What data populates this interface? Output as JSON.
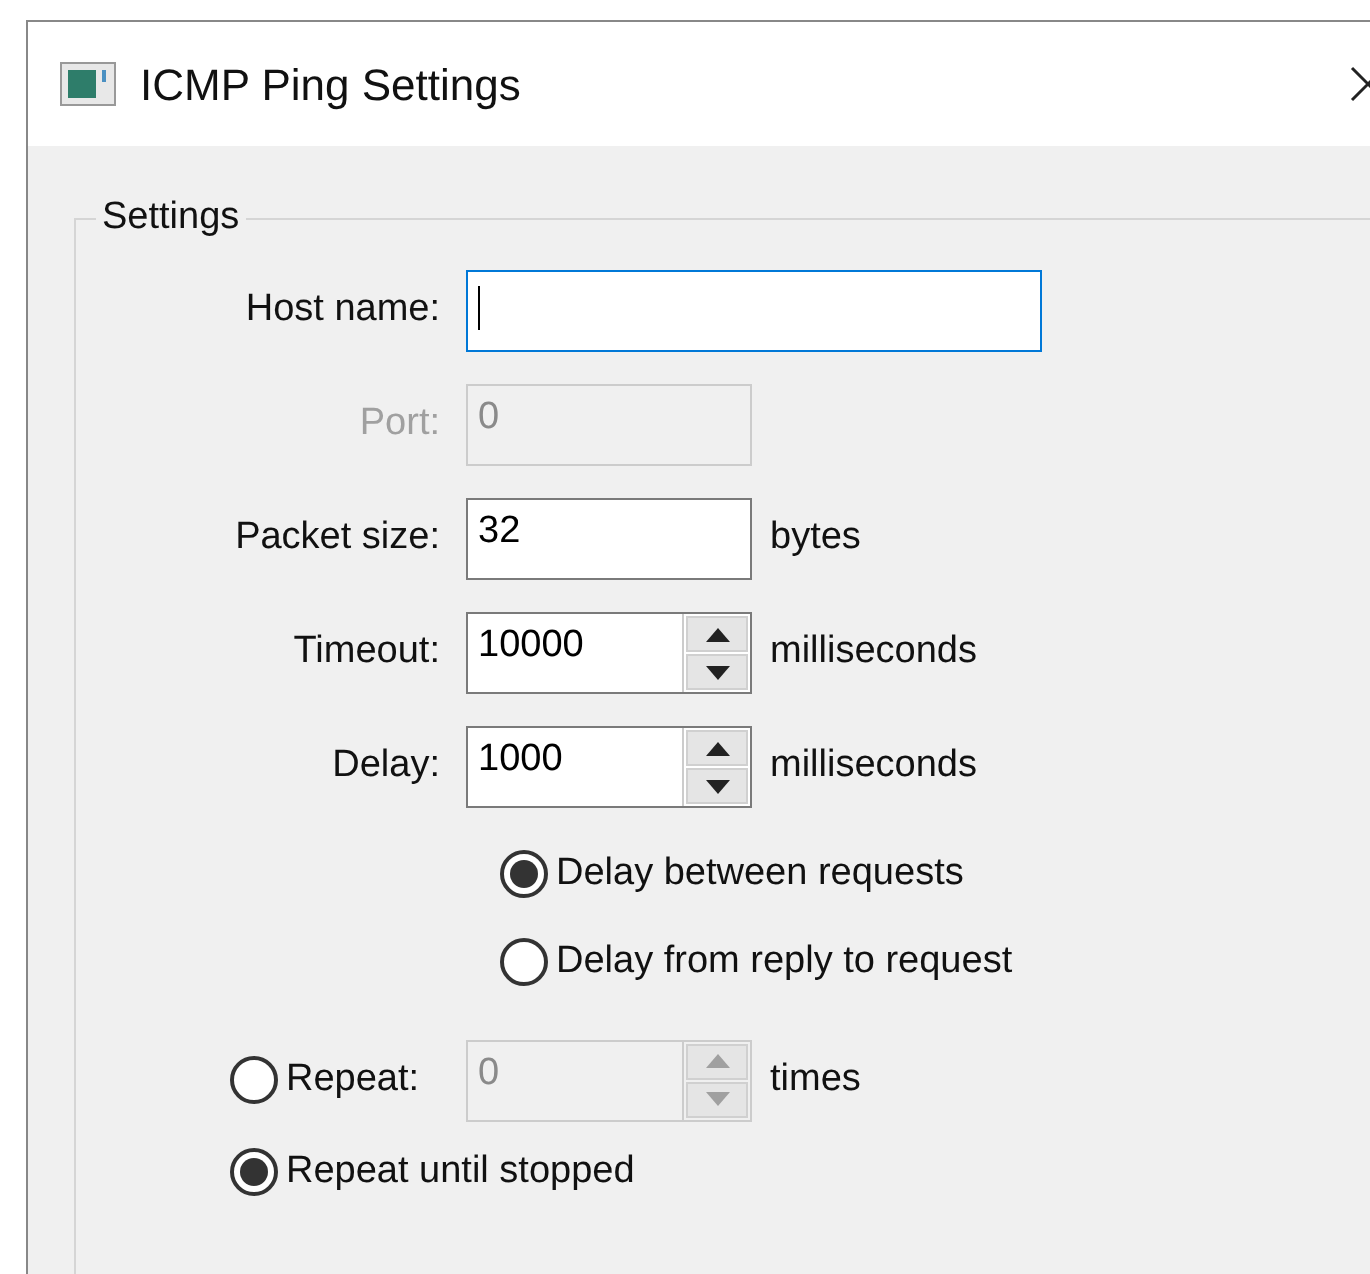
{
  "window": {
    "title": "ICMP Ping Settings"
  },
  "group": {
    "title": "Settings"
  },
  "fields": [
    {
      "label": "Host name:",
      "kind": "text",
      "disabled": false,
      "focused": true
    },
    {
      "label": "Port:",
      "kind": "text",
      "value": "0",
      "disabled": true,
      "focused": false
    },
    {
      "label": "Packet size:",
      "kind": "text",
      "value": "32",
      "disabled": false,
      "focused": false,
      "unit": "bytes"
    },
    {
      "label": "Timeout:",
      "kind": "spin",
      "value": "10000",
      "disabled": false,
      "focused": false,
      "unit": "milliseconds"
    },
    {
      "label": "Delay:",
      "kind": "spin",
      "value": "1000",
      "disabled": false,
      "focused": false,
      "unit": "milliseconds"
    }
  ],
  "delay_modes": [
    {
      "label": "Delay between requests",
      "selected": true
    },
    {
      "label": "Delay from reply to request",
      "selected": false
    }
  ],
  "repeat_modes": [
    {
      "label": "Repeat:",
      "selected": false,
      "kind": "count",
      "field": {
        "kind": "spin",
        "value": "0",
        "disabled": true,
        "focused": false,
        "unit": "times"
      }
    },
    {
      "label": "Repeat until stopped",
      "selected": true,
      "kind": "plain"
    }
  ]
}
